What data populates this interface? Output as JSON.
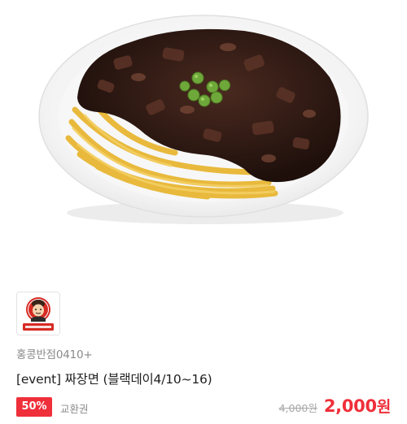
{
  "product": {
    "image_alt": "짜장면",
    "brand_logo_text": "홍콩반점0410",
    "brand_name": "홍콩반점0410+",
    "title": "[event] 짜장면 (블랙데이4/10~16)",
    "discount": "50%",
    "coupon_type": "교환권",
    "original_price": "4,000원",
    "sale_price": "2,000",
    "currency": "원"
  },
  "colors": {
    "accent": "#ef2f3a",
    "muted_text": "#8a8a8a"
  }
}
